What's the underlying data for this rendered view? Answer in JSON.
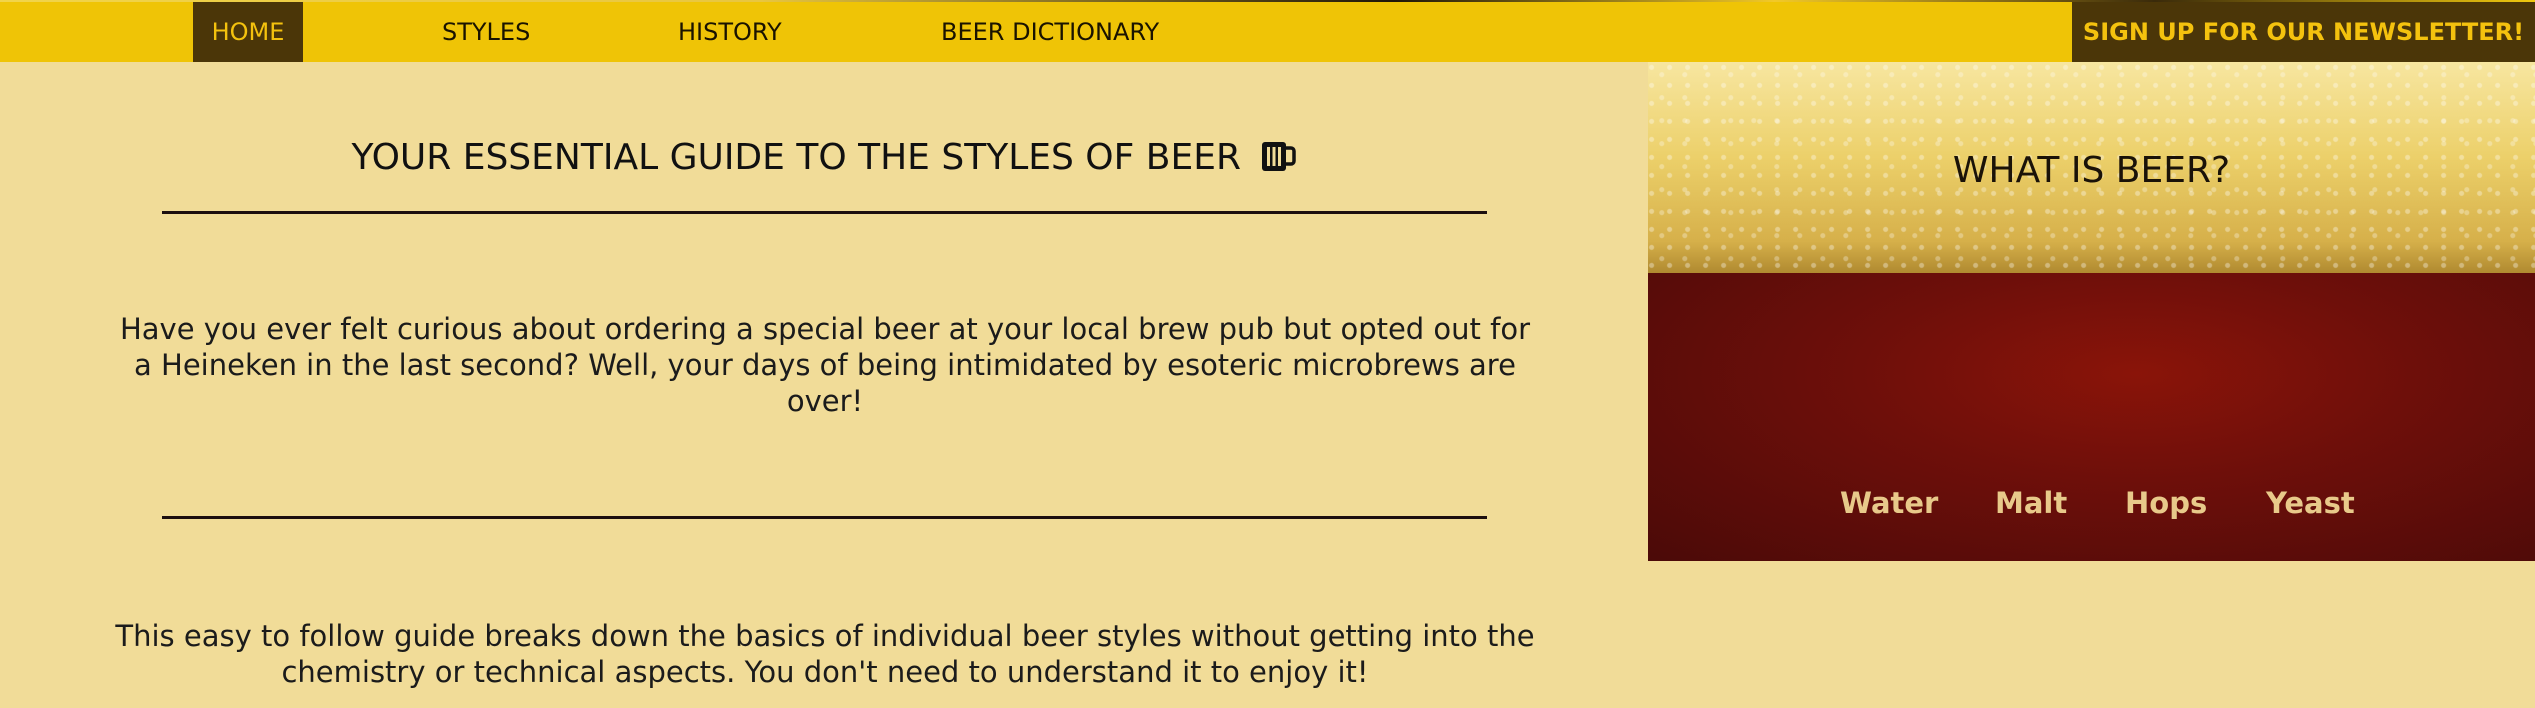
{
  "nav": {
    "items": [
      {
        "label": "HOME"
      },
      {
        "label": "STYLES"
      },
      {
        "label": "HISTORY"
      },
      {
        "label": "BEER DICTIONARY"
      }
    ],
    "newsletter_label": "SIGN UP FOR OUR NEWSLETTER!"
  },
  "main": {
    "title": "YOUR ESSENTIAL GUIDE TO THE STYLES OF BEER",
    "title_icon": "beer-mug-icon",
    "paragraph_1": "Have you ever felt curious about ordering a special beer at your local brew pub but opted out for a Heineken in the last second? Well, your days of being intimidated by esoteric microbrews are over!",
    "paragraph_2": "This easy to follow guide breaks down the basics of individual beer styles without getting into the chemistry or technical aspects. You don't need to understand it to enjoy it!"
  },
  "hero": {
    "title": "WHAT IS BEER?",
    "ingredients": [
      "Water",
      "Malt",
      "Hops",
      "Yeast"
    ]
  },
  "colors": {
    "page_background": "#f1dc98",
    "nav_background": "#efc406",
    "nav_active_background": "#4b3608",
    "nav_active_text": "#f4c20e",
    "ingredient_text": "#e8c98a"
  }
}
